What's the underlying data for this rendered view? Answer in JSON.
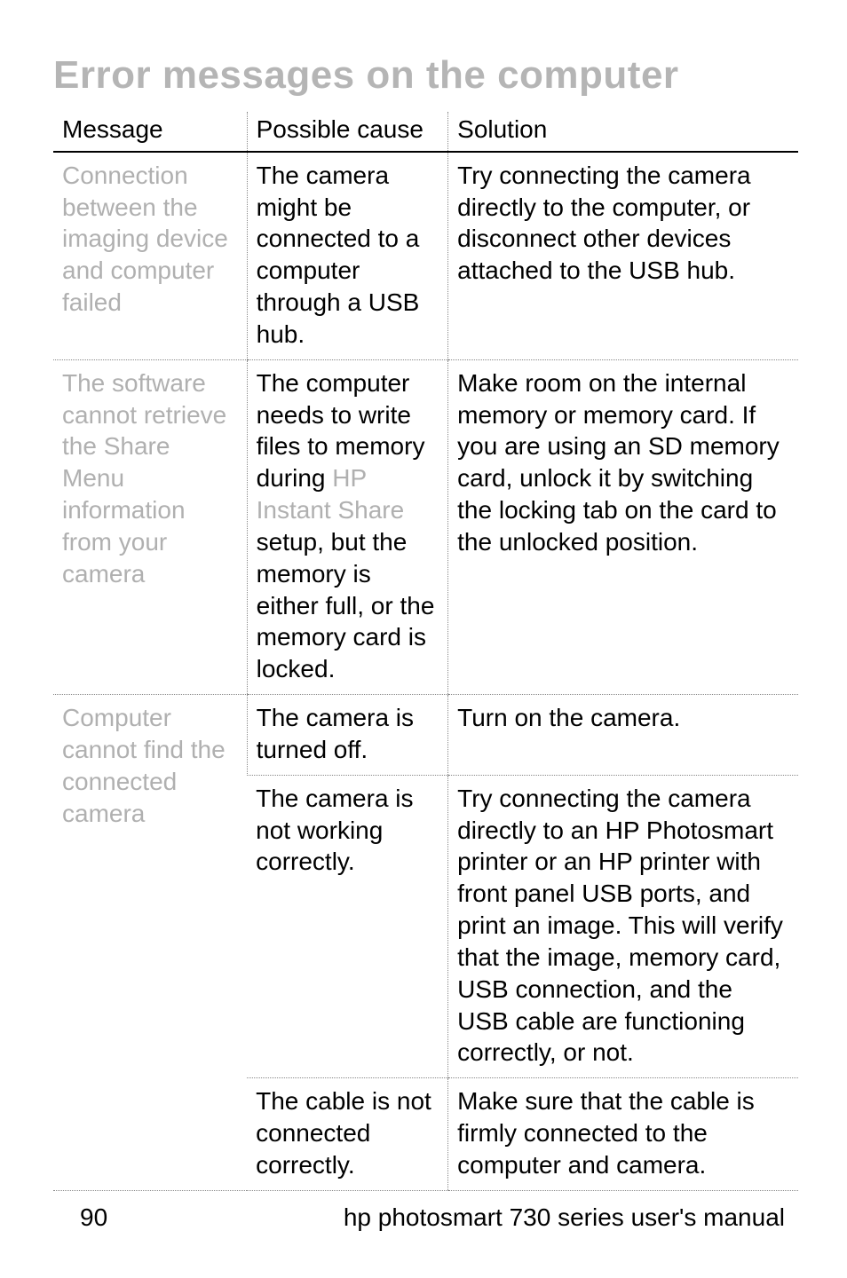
{
  "title": "Error messages on the computer",
  "headers": {
    "c1": "Message",
    "c2": "Possible cause",
    "c3": "Solution"
  },
  "rows": {
    "r1": {
      "msg": "Connection between the imaging device and computer failed",
      "cause": "The camera might be connected to a computer through a USB hub.",
      "sol": "Try connecting the camera directly to the computer, or disconnect other devices attached to the USB hub."
    },
    "r2": {
      "msg": "The software cannot retrieve the Share Menu information from your camera",
      "cause_a": "The computer needs to write files to memory during ",
      "cause_faded": "HP Instant Share",
      "cause_b": " setup, but the memory is either full, or the memory card is locked.",
      "sol": "Make room on the internal memory or memory card. If you are using an SD memory card, unlock it by switching the locking tab on the card to the unlocked position."
    },
    "r3": {
      "msg": "Computer cannot find the connected camera",
      "sub1": {
        "cause": "The camera is turned off.",
        "sol": "Turn on the camera."
      },
      "sub2": {
        "cause": "The camera is not working correctly.",
        "sol": "Try connecting the camera directly to an HP Photosmart printer or an HP printer with front panel USB ports, and print an image. This will verify that the image, memory card, USB connection, and the USB cable are functioning correctly, or not."
      },
      "sub3": {
        "cause": "The cable is not connected correctly.",
        "sol": "Make sure that the cable is firmly connected to the computer and camera."
      }
    }
  },
  "footer": {
    "page": "90",
    "doc": "hp photosmart 730 series user's manual"
  }
}
